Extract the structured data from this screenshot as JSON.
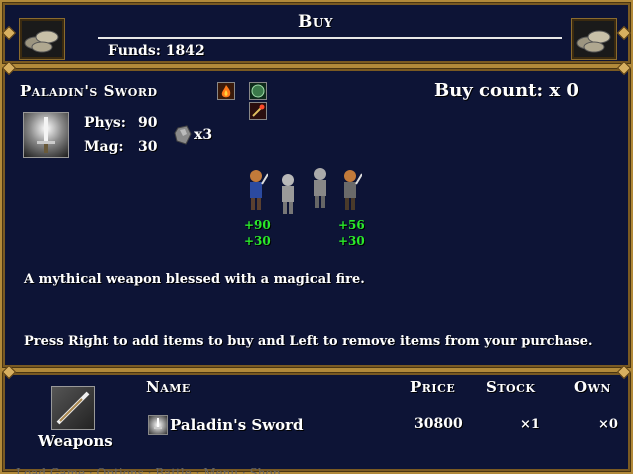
{
  "header": {
    "title": "Buy",
    "funds_label": "Funds: 1842"
  },
  "item": {
    "name": "Paladin's Sword",
    "phys_label": "Phys:",
    "phys_value": "90",
    "mag_label": "Mag:",
    "mag_value": "30",
    "material_count": "x3",
    "buy_count": "Buy count: x 0",
    "description": "A mythical weapon blessed with a magical fire.",
    "party_bonus": [
      {
        "phys": "+90",
        "mag": "+30"
      },
      {
        "phys": "",
        "mag": ""
      },
      {
        "phys": "",
        "mag": ""
      },
      {
        "phys": "+56",
        "mag": "+30"
      }
    ]
  },
  "help_text": "Press Right to add items to buy and Left to remove items from your purchase.",
  "shop": {
    "category_label": "Weapons",
    "columns": {
      "name": "Name",
      "price": "Price",
      "stock": "Stock",
      "own": "Own"
    },
    "rows": [
      {
        "name": "Paladin's Sword",
        "price": "30800",
        "stock": "×1",
        "own": "×0"
      }
    ]
  },
  "footer_hint": "Load Game · Options · Battle · Menu · Shop",
  "colors": {
    "border": "#b28a3a",
    "panel": "#0d1436",
    "bonus": "#2aea2a"
  }
}
